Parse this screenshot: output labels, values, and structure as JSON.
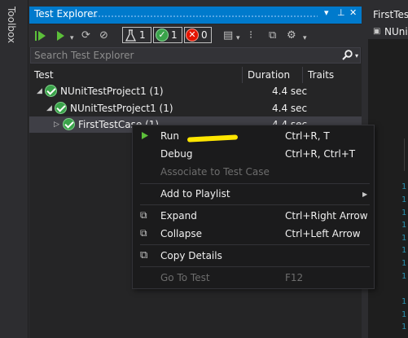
{
  "toolbox": {
    "label": "Toolbox"
  },
  "test_explorer": {
    "title": "Test Explorer",
    "title_controls": [
      "▾",
      "⊥",
      "✕"
    ],
    "toolbar": {
      "flask_count": "1",
      "passed_count": "1",
      "failed_count": "0"
    },
    "search_placeholder": "Search Test Explorer",
    "columns": {
      "test": "Test",
      "duration": "Duration",
      "traits": "Traits"
    },
    "rows": [
      {
        "name": "NUnitTestProject1 (1)",
        "duration": "4.4 sec"
      },
      {
        "name": "NUnitTestProject1 (1)",
        "duration": "4.4 sec"
      },
      {
        "name": "FirstTestCase (1)",
        "duration": "4.4 sec"
      }
    ]
  },
  "editor": {
    "tab_label": "FirstTest",
    "tab_label2": "NUni",
    "line_prefix": "1"
  },
  "context_menu": {
    "items": [
      {
        "label": "Run",
        "shortcut": "Ctrl+R, T"
      },
      {
        "label": "Debug",
        "shortcut": "Ctrl+R, Ctrl+T"
      },
      {
        "label": "Associate to Test Case",
        "shortcut": ""
      },
      {
        "label": "Add to Playlist",
        "shortcut": ""
      },
      {
        "label": "Expand",
        "shortcut": "Ctrl+Right Arrow"
      },
      {
        "label": "Collapse",
        "shortcut": "Ctrl+Left Arrow"
      },
      {
        "label": "Copy Details",
        "shortcut": ""
      },
      {
        "label": "Go To Test",
        "shortcut": "F12"
      }
    ]
  },
  "colors": {
    "accent": "#007acc",
    "pass": "#3aa34a",
    "fail": "#e51400",
    "highlight": "#ffe600"
  }
}
